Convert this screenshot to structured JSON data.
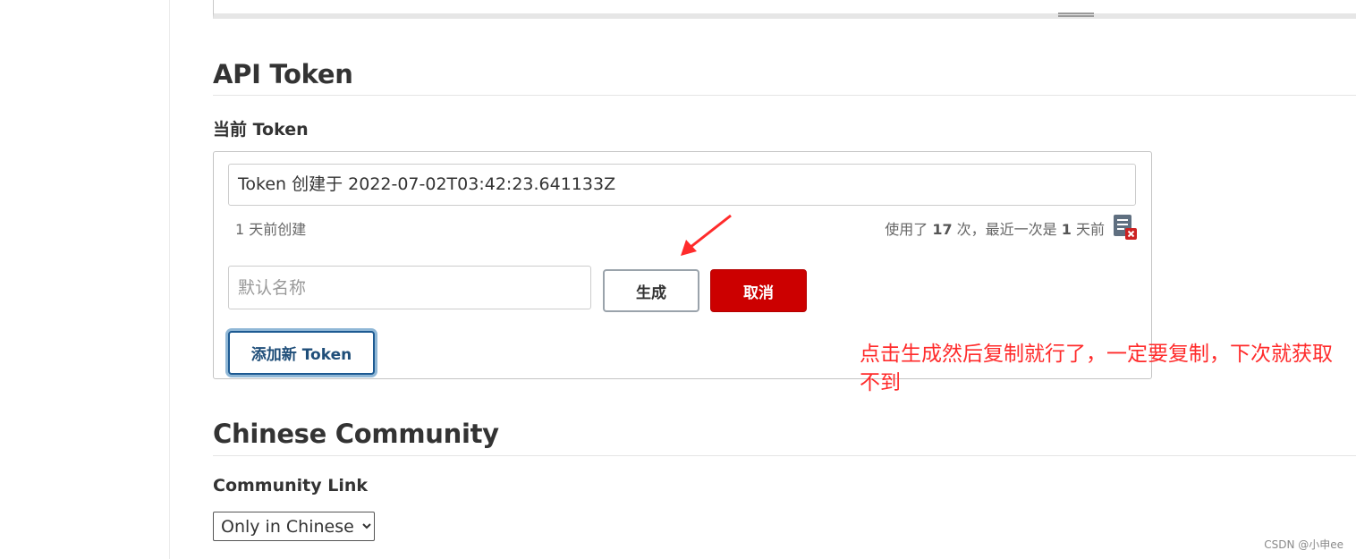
{
  "api_token": {
    "heading": "API Token",
    "current_label": "当前 Token",
    "token_name": "Token 创建于 2022-07-02T03:42:23.641133Z",
    "created_ago": "1 天前创建",
    "usage": {
      "prefix": "使用了 ",
      "count": "17",
      "mid": " 次，最近一次是 ",
      "last_used": "1",
      "suffix": " 天前"
    },
    "revoke_icon": "document-revoke-icon",
    "name_placeholder": "默认名称",
    "generate_label": "生成",
    "cancel_label": "取消",
    "add_label": "添加新 Token"
  },
  "annotation": {
    "text": "点击生成然后复制就行了，一定要复制，下次就获取不到",
    "color": "#ff2b2b"
  },
  "community": {
    "heading": "Chinese Community",
    "link_label": "Community Link",
    "selected": "Only in Chinese"
  },
  "watermark": "CSDN @小申ee",
  "colors": {
    "cancel_bg": "#cc0000",
    "add_border": "#1d5a92",
    "text": "#333333"
  }
}
